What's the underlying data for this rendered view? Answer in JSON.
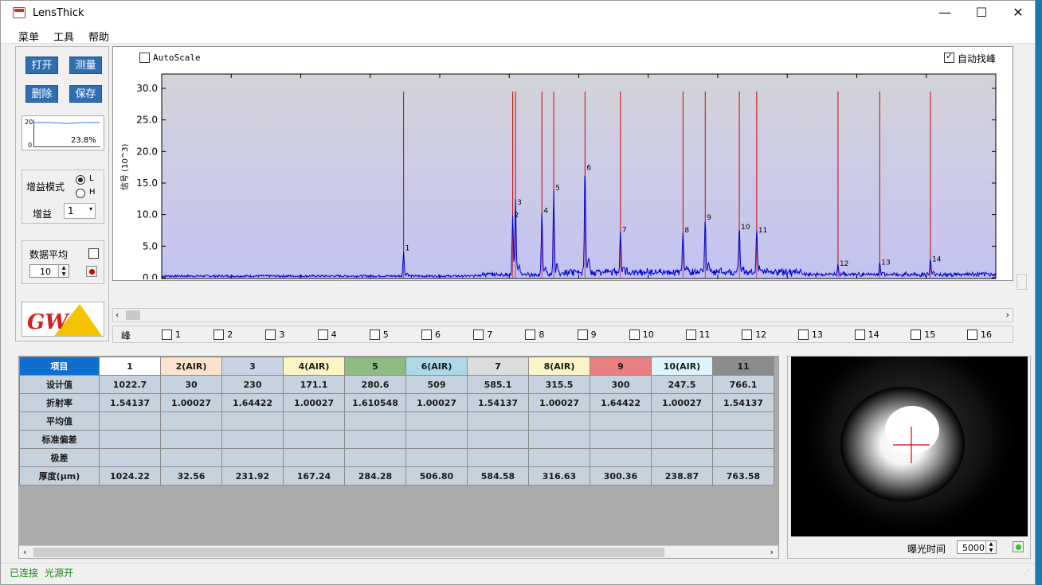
{
  "window": {
    "title": "LensThick",
    "minimize": "—",
    "maximize": "☐",
    "close": "✕"
  },
  "menu": [
    "菜单",
    "工具",
    "帮助"
  ],
  "toolbar": {
    "open": "打开",
    "measure": "测量",
    "delete": "删除",
    "save": "保存"
  },
  "mini_chart": {
    "ymax": "20",
    "ymin": "0",
    "percent": "23.8%"
  },
  "gain": {
    "mode_label": "增益模式",
    "option_l": "L",
    "option_h": "H",
    "selected": "L",
    "gain_label": "增益",
    "gain_value": "1"
  },
  "averaging": {
    "label": "数据平均",
    "checked": false,
    "count": "10"
  },
  "chart": {
    "autoscale_label": "AutoScale",
    "autoscale_checked": false,
    "auto_peak_label": "自动找峰",
    "auto_peak_checked": true,
    "ylabel": "信号 (10^3)",
    "colors": {
      "plot_bg_top": "#d3d3d9",
      "plot_bg_bottom": "#c3c3f3",
      "signal": "#0000cc",
      "marker": "#d00000"
    }
  },
  "chart_data": {
    "type": "line",
    "title": "",
    "xlabel": "",
    "ylabel": "信号 (10^3)",
    "xlim": [
      0.0,
      12.0
    ],
    "ylim": [
      0.0,
      30.0
    ],
    "x_ticks": [
      "0.0",
      "1.0",
      "2.0",
      "3.0",
      "4.0",
      "5.0",
      "6.0",
      "7.0",
      "8.0",
      "9.0",
      "10.0",
      "11.0",
      "12.0"
    ],
    "y_ticks": [
      "0.0",
      "5.0",
      "10.0",
      "15.0",
      "20.0",
      "25.0",
      "30.0"
    ],
    "grid": false,
    "series": [
      {
        "peaks": [
          {
            "label": "1",
            "x": 3.48,
            "y": 4.0
          },
          {
            "label": "2",
            "x": 5.05,
            "y": 9.2
          },
          {
            "label": "3",
            "x": 5.09,
            "y": 11.2
          },
          {
            "label": "4",
            "x": 5.47,
            "y": 9.9
          },
          {
            "label": "5",
            "x": 5.64,
            "y": 13.5
          },
          {
            "label": "6",
            "x": 6.09,
            "y": 16.7
          },
          {
            "label": "7",
            "x": 6.6,
            "y": 6.9
          },
          {
            "label": "8",
            "x": 7.5,
            "y": 6.8
          },
          {
            "label": "9",
            "x": 7.82,
            "y": 8.8
          },
          {
            "label": "10",
            "x": 8.31,
            "y": 7.3
          },
          {
            "label": "11",
            "x": 8.56,
            "y": 6.8
          },
          {
            "label": "12",
            "x": 9.73,
            "y": 1.5
          },
          {
            "label": "13",
            "x": 10.33,
            "y": 1.7
          },
          {
            "label": "14",
            "x": 11.06,
            "y": 2.2
          }
        ]
      }
    ],
    "markers_x": [
      3.48,
      5.05,
      5.09,
      5.47,
      5.64,
      6.09,
      6.6,
      7.5,
      7.82,
      8.31,
      8.56,
      9.73,
      10.33,
      11.06
    ],
    "marker_height": 29.5
  },
  "peak_bar": {
    "label": "峰",
    "items": [
      "1",
      "2",
      "3",
      "4",
      "5",
      "6",
      "7",
      "8",
      "9",
      "10",
      "11",
      "12",
      "13",
      "14",
      "15",
      "16"
    ]
  },
  "table": {
    "header_label": "项目",
    "columns": [
      {
        "name": "1",
        "color": "#ffffff"
      },
      {
        "name": "2(AIR)",
        "color": "#fbe3cd"
      },
      {
        "name": "3",
        "color": "#c8d4e4"
      },
      {
        "name": "4(AIR)",
        "color": "#fbf5c6"
      },
      {
        "name": "5",
        "color": "#90ba84"
      },
      {
        "name": "6(AIR)",
        "color": "#add8e8"
      },
      {
        "name": "7",
        "color": "#dcdcdc"
      },
      {
        "name": "8(AIR)",
        "color": "#fbf5c6"
      },
      {
        "name": "9",
        "color": "#e88080"
      },
      {
        "name": "10(AIR)",
        "color": "#dcf4fb"
      },
      {
        "name": "11",
        "color": "#8c8c8c"
      }
    ],
    "rows": [
      {
        "label": "设计值",
        "values": [
          "1022.7",
          "30",
          "230",
          "171.1",
          "280.6",
          "509",
          "585.1",
          "315.5",
          "300",
          "247.5",
          "766.1"
        ]
      },
      {
        "label": "折射率",
        "values": [
          "1.54137",
          "1.00027",
          "1.64422",
          "1.00027",
          "1.610548",
          "1.00027",
          "1.54137",
          "1.00027",
          "1.64422",
          "1.00027",
          "1.54137"
        ]
      },
      {
        "label": "平均值",
        "values": [
          "",
          "",
          "",
          "",
          "",
          "",
          "",
          "",
          "",
          "",
          ""
        ]
      },
      {
        "label": "标准偏差",
        "values": [
          "",
          "",
          "",
          "",
          "",
          "",
          "",
          "",
          "",
          "",
          ""
        ]
      },
      {
        "label": "极差",
        "values": [
          "",
          "",
          "",
          "",
          "",
          "",
          "",
          "",
          "",
          "",
          ""
        ]
      },
      {
        "label": "厚度(μm)",
        "values": [
          "1024.22",
          "32.56",
          "231.92",
          "167.24",
          "284.28",
          "506.80",
          "584.58",
          "316.63",
          "300.36",
          "238.87",
          "763.58"
        ]
      }
    ]
  },
  "camera": {
    "exposure_label": "曝光时间",
    "exposure_value": "5000",
    "led_color": "#22cc22"
  },
  "status": {
    "connected": "已连接",
    "light": "光源开"
  }
}
